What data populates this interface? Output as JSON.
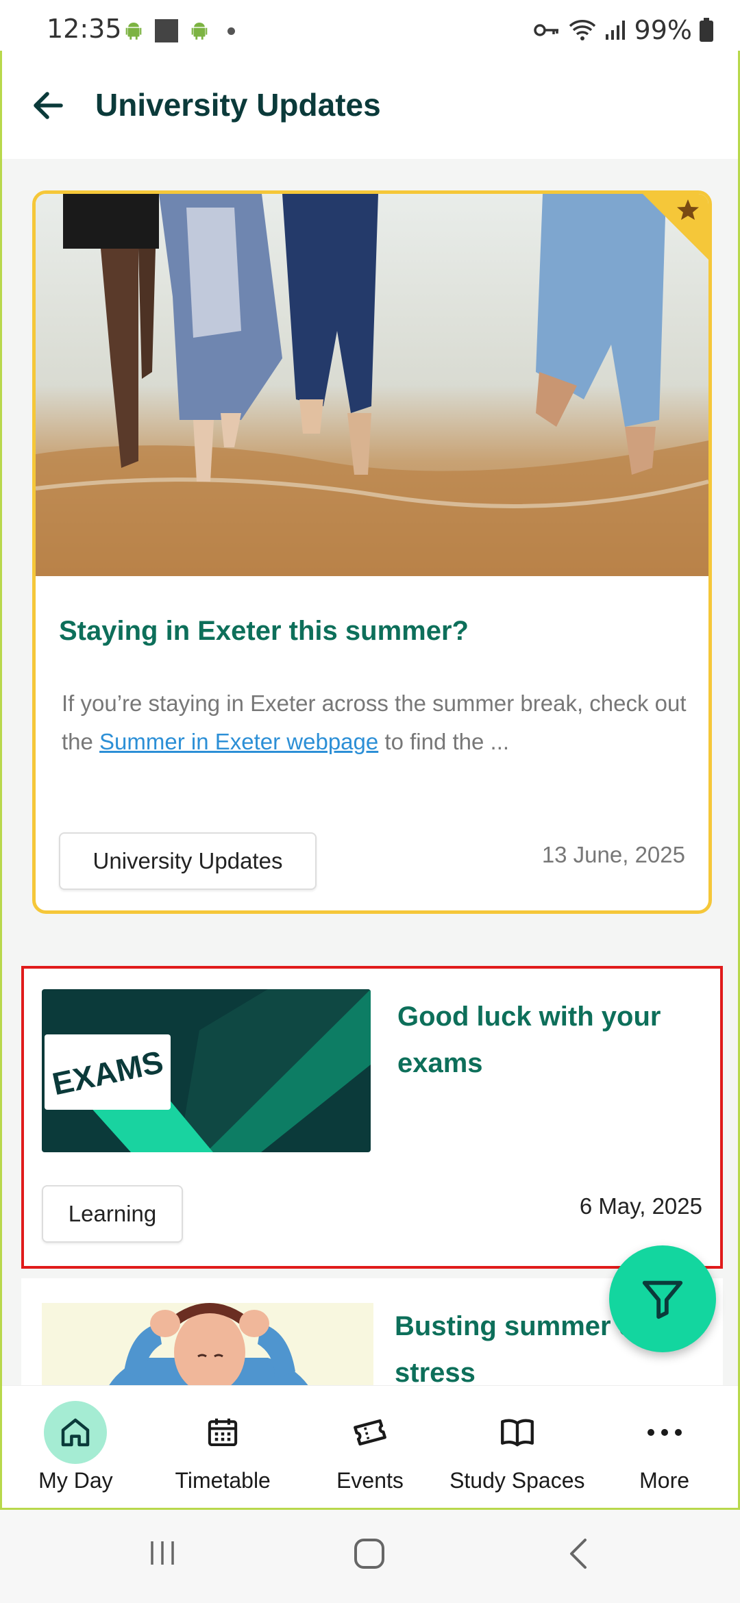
{
  "status_bar": {
    "time": "12:35",
    "battery": "99%",
    "icons": [
      "android-icon",
      "square-icon",
      "android-icon",
      "dot-icon",
      "key-icon",
      "wifi-icon",
      "signal-icon",
      "battery-icon"
    ]
  },
  "header": {
    "title": "University Updates",
    "back_icon": "arrow-left-icon"
  },
  "featured_card": {
    "title": "Staying in Exeter this summer?",
    "excerpt_before": "If you’re staying in Exeter across the summer break, check out the ",
    "excerpt_link": "Summer in Exeter webpage",
    "excerpt_after": " to find the ...",
    "tag": "University Updates",
    "date": "13 June, 2025",
    "starred": true,
    "accent_color": "#f5c739"
  },
  "news_items": [
    {
      "title": "Good luck with your exams",
      "thumbnail_text": "EXAMS",
      "tag": "Learning",
      "date": "6 May, 2025"
    },
    {
      "title": "Busting summer exam stress"
    }
  ],
  "bottom_nav": {
    "items": [
      {
        "label": "My Day",
        "icon": "home-icon",
        "active": true
      },
      {
        "label": "Timetable",
        "icon": "calendar-icon",
        "active": false
      },
      {
        "label": "Events",
        "icon": "ticket-icon",
        "active": false
      },
      {
        "label": "Study Spaces",
        "icon": "book-icon",
        "active": false
      },
      {
        "label": "More",
        "icon": "more-icon",
        "active": false
      }
    ]
  },
  "colors": {
    "title_dark": "#0b3a3a",
    "title_green": "#0d6f5a",
    "fab": "#13d69f",
    "active_nav": "#a5ecd3",
    "frame_border": "#b8d84c"
  }
}
